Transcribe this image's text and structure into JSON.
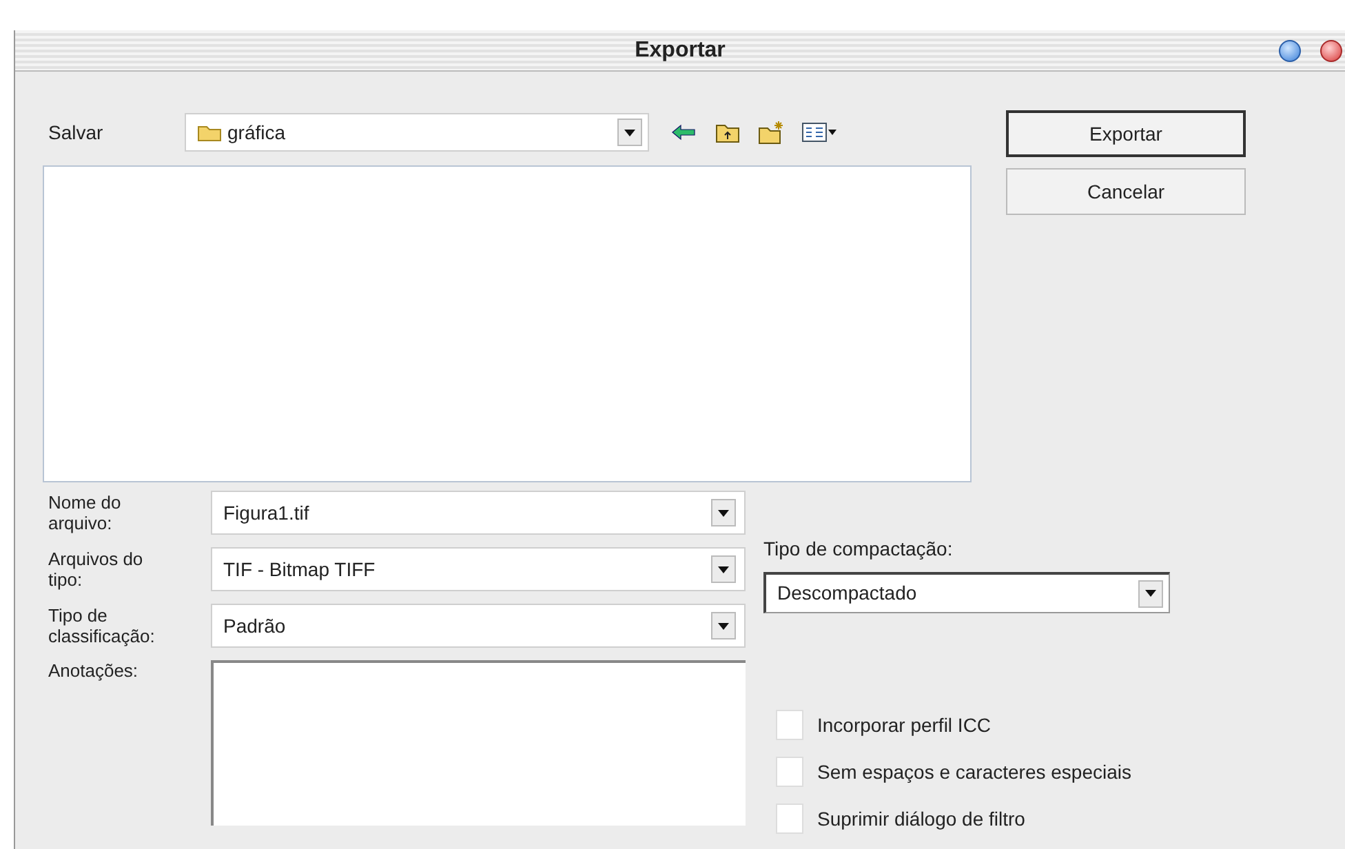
{
  "window": {
    "title": "Exportar"
  },
  "save_in": {
    "label": "Salvar",
    "value": "gráfica"
  },
  "buttons": [
    {
      "label": "Exportar",
      "default": true
    },
    {
      "label": "Cancelar",
      "default": false
    }
  ],
  "fields": [
    {
      "label": "Nome do arquivo:",
      "value": "Figura1.tif"
    },
    {
      "label": "Arquivos do tipo:",
      "value": "TIF - Bitmap TIFF"
    },
    {
      "label": "Tipo de classificação:",
      "value": "Padrão"
    }
  ],
  "annotations": {
    "label": "Anotações:"
  },
  "compression": {
    "label": "Tipo de compactação:",
    "value": "Descompactado"
  },
  "options": [
    {
      "label": "Incorporar perfil ICC",
      "checked": false
    },
    {
      "label": "Sem espaços e caracteres especiais",
      "checked": false
    },
    {
      "label": "Suprimir diálogo de filtro",
      "checked": false
    }
  ]
}
